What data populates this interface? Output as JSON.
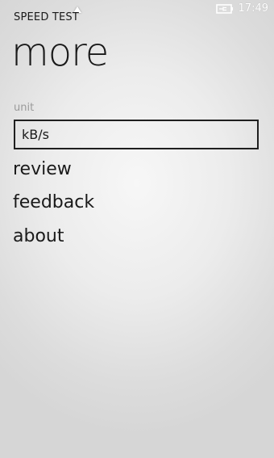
{
  "status_bar": {
    "time": "17:49",
    "signal_icon": "signal-triangle-icon",
    "battery_icon": "battery-charging-icon"
  },
  "app": {
    "name": "SPEED TEST"
  },
  "page": {
    "title": "more"
  },
  "settings": {
    "unit_label": "unit",
    "unit_value": "kB/s"
  },
  "menu": {
    "review": "review",
    "feedback": "feedback",
    "about": "about"
  }
}
